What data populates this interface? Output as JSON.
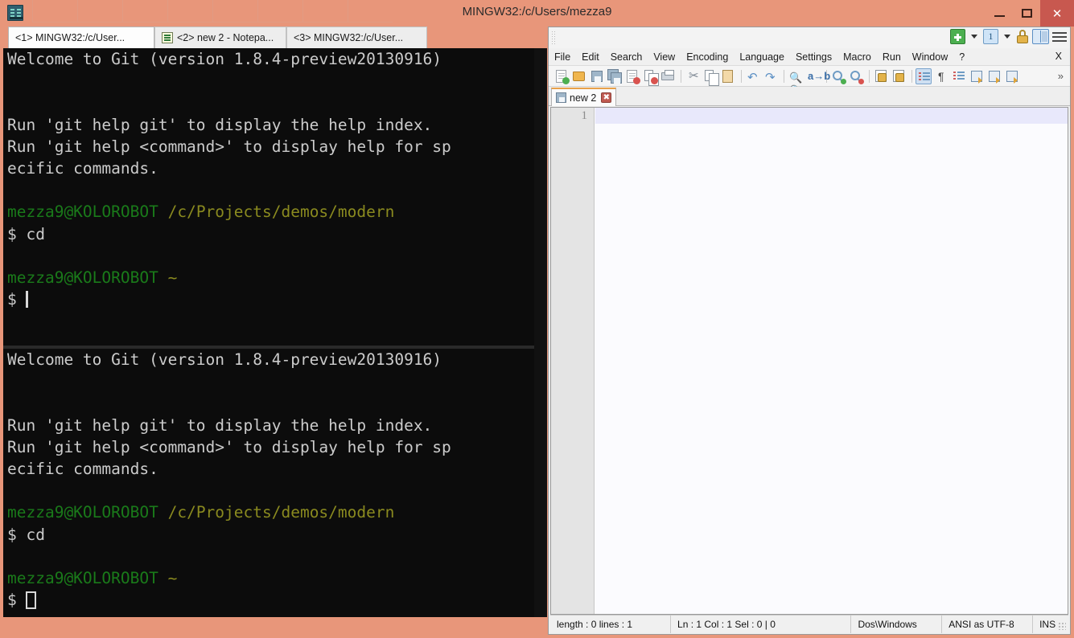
{
  "window": {
    "title": "MINGW32:/c/Users/mezza9",
    "app_icon": "conemu-icon",
    "minimize_label": "—",
    "maximize_label": "□",
    "close_label": "✕"
  },
  "console_tabs": [
    {
      "label": "<1> MINGW32:/c/User...",
      "active": true,
      "icon": null
    },
    {
      "label": "<2> new  2 - Notepa...",
      "active": false,
      "icon": "notepad-plus-plus-icon"
    },
    {
      "label": "<3> MINGW32:/c/User...",
      "active": false,
      "icon": null
    }
  ],
  "terminal": {
    "top_pane": {
      "lines": [
        {
          "segments": [
            {
              "text": "Welcome to Git (version 1.8.4-preview20130916)",
              "color": "normal"
            }
          ]
        },
        {
          "segments": []
        },
        {
          "segments": []
        },
        {
          "segments": [
            {
              "text": "Run 'git help git' to display the help index.",
              "color": "normal"
            }
          ]
        },
        {
          "segments": [
            {
              "text": "Run 'git help <command>' to display help for sp",
              "color": "normal"
            }
          ]
        },
        {
          "segments": [
            {
              "text": "ecific commands.",
              "color": "normal"
            }
          ]
        },
        {
          "segments": []
        },
        {
          "segments": [
            {
              "text": "mezza9@KOLOROBOT ",
              "color": "user"
            },
            {
              "text": "/c/Projects/demos/modern",
              "color": "path"
            }
          ]
        },
        {
          "segments": [
            {
              "text": "$ cd",
              "color": "normal"
            }
          ]
        },
        {
          "segments": []
        },
        {
          "segments": [
            {
              "text": "mezza9@KOLOROBOT ",
              "color": "user"
            },
            {
              "text": "~",
              "color": "path"
            }
          ]
        },
        {
          "segments": [
            {
              "text": "$ ",
              "color": "normal"
            }
          ],
          "cursor": "thin"
        }
      ]
    },
    "bottom_pane": {
      "lines": [
        {
          "segments": [
            {
              "text": "Welcome to Git (version 1.8.4-preview20130916)",
              "color": "normal"
            }
          ]
        },
        {
          "segments": []
        },
        {
          "segments": []
        },
        {
          "segments": [
            {
              "text": "Run 'git help git' to display the help index.",
              "color": "normal"
            }
          ]
        },
        {
          "segments": [
            {
              "text": "Run 'git help <command>' to display help for sp",
              "color": "normal"
            }
          ]
        },
        {
          "segments": [
            {
              "text": "ecific commands.",
              "color": "normal"
            }
          ]
        },
        {
          "segments": []
        },
        {
          "segments": [
            {
              "text": "mezza9@KOLOROBOT ",
              "color": "user"
            },
            {
              "text": "/c/Projects/demos/modern",
              "color": "path"
            }
          ]
        },
        {
          "segments": [
            {
              "text": "$ cd",
              "color": "normal"
            }
          ]
        },
        {
          "segments": []
        },
        {
          "segments": [
            {
              "text": "mezza9@KOLOROBOT ",
              "color": "user"
            },
            {
              "text": "~",
              "color": "path"
            }
          ]
        },
        {
          "segments": [
            {
              "text": "$ ",
              "color": "normal"
            }
          ],
          "cursor": "box"
        }
      ]
    },
    "colors": {
      "background": "#0c0c0c",
      "normal_text": "#cccccc",
      "user_host": "#1a7a1a",
      "path": "#8a8a1f"
    }
  },
  "notepad": {
    "right_icons": [
      {
        "name": "new-tab-plus-icon"
      },
      {
        "name": "new-tab-dropdown-caret-icon"
      },
      {
        "name": "active-console-number-icon",
        "label": "1"
      },
      {
        "name": "console-list-dropdown-caret-icon"
      },
      {
        "name": "lock-icon"
      },
      {
        "name": "split-view-icon"
      },
      {
        "name": "hamburger-menu-icon"
      }
    ],
    "menus": [
      "File",
      "Edit",
      "Search",
      "View",
      "Encoding",
      "Language",
      "Settings",
      "Macro",
      "Run",
      "Window",
      "?"
    ],
    "menu_close_label": "X",
    "toolbar_overflow_label": "»",
    "toolbar_items": [
      "new-document-icon",
      "open-folder-icon",
      "save-icon",
      "save-all-icon",
      "close-document-icon",
      "close-all-documents-icon",
      "print-icon",
      "sep",
      "cut-icon",
      "copy-icon",
      "paste-icon",
      "sep",
      "undo-icon",
      "redo-icon",
      "sep",
      "find-icon",
      "replace-icon",
      "sep",
      "zoom-in-icon",
      "zoom-out-icon",
      "sep",
      "sync-vertical-scroll-icon",
      "sync-horizontal-scroll-icon",
      "sep",
      "word-wrap-icon",
      "show-all-characters-icon",
      "indent-guide-icon",
      "user-defined-language-icon",
      "document-map-icon",
      "function-list-icon"
    ],
    "document_tab": {
      "label": "new  2",
      "save_icon": "floppy-disk-icon",
      "close_icon": "close-tab-icon",
      "close_label": "✖"
    },
    "editor": {
      "line_numbers": [
        "1"
      ],
      "content": ""
    },
    "statusbar": {
      "length_lines": "length : 0    lines : 1",
      "position": "Ln : 1    Col : 1    Sel : 0 | 0",
      "eol": "Dos\\Windows",
      "encoding": "ANSI as UTF-8",
      "insert_mode": "INS"
    }
  },
  "colors": {
    "title_bar": "#e8967a",
    "close_button": "#c8584f",
    "accent_tab_top": "#e8a14a",
    "current_line": "#e8e8fb"
  }
}
